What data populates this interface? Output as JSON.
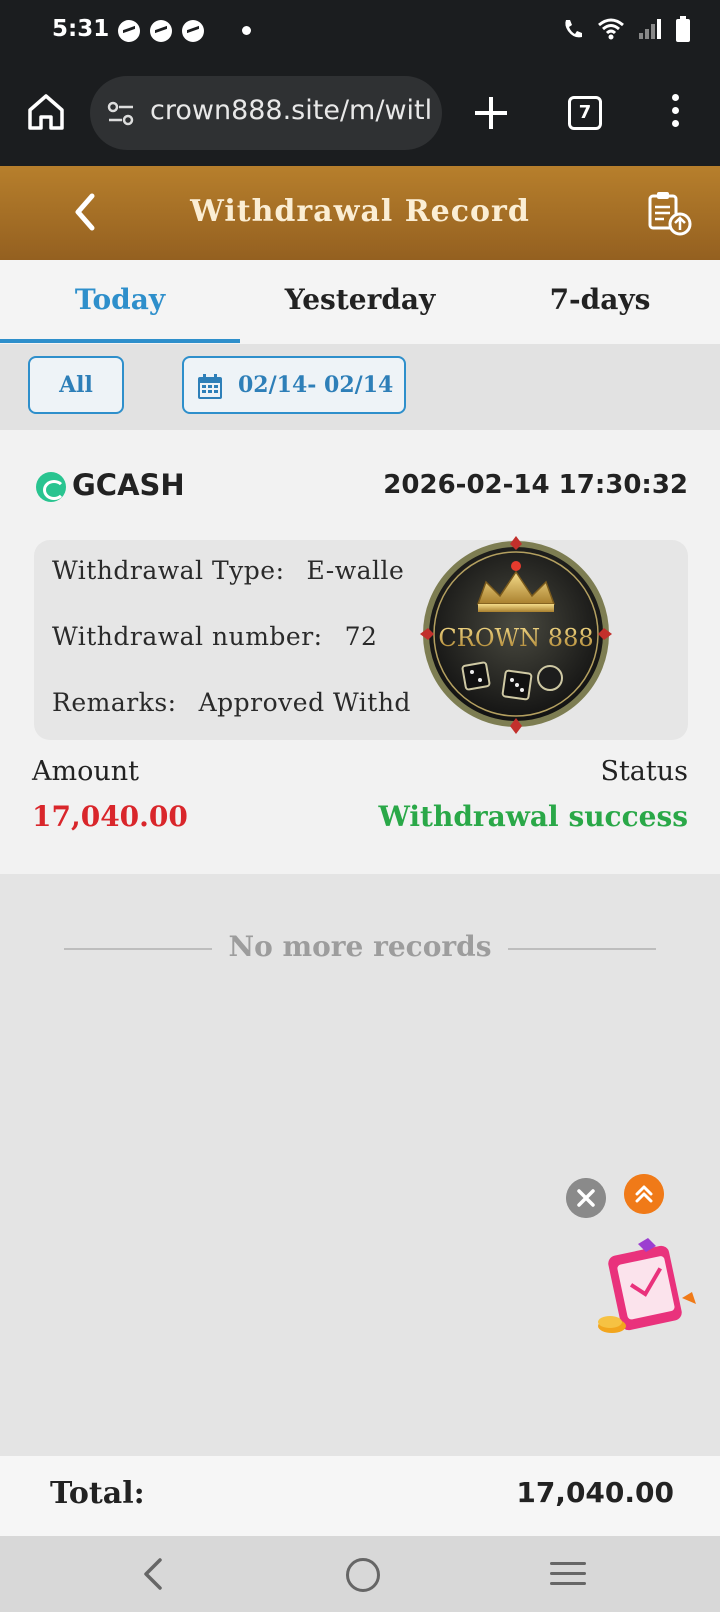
{
  "status_bar": {
    "time": "5:31",
    "notification_icons": [
      "messenger-icon",
      "messenger-icon",
      "messenger-icon"
    ],
    "system_icons": [
      "wifi-calling-icon",
      "wifi-icon",
      "signal-icon",
      "battery-icon"
    ]
  },
  "browser": {
    "url": "crown888.site/m/witl",
    "tab_count": "7"
  },
  "header": {
    "title": "Withdrawal Record"
  },
  "tabs": [
    {
      "label": "Today",
      "active": true
    },
    {
      "label": "Yesterday",
      "active": false
    },
    {
      "label": "7-days",
      "active": false
    }
  ],
  "filters": {
    "all_label": "All",
    "date_range": "02/14- 02/14"
  },
  "record": {
    "channel": "GCASH",
    "datetime": "2026-02-14 17:30:32",
    "type_label": "Withdrawal Type:",
    "type_value": "E-walle",
    "number_label": "Withdrawal number:",
    "number_value": "72",
    "remarks_label": "Remarks:",
    "remarks_value": "Approved Withd",
    "amount_label": "Amount",
    "amount_value": "17,040.00",
    "status_label": "Status",
    "status_value": "Withdrawal success"
  },
  "watermark": {
    "text": "CROWN 888"
  },
  "list_end_text": "No more records",
  "footer": {
    "total_label": "Total:",
    "total_value": "17,040.00"
  },
  "colors": {
    "header_gold": "#b77f2c",
    "accent_blue": "#2e8fcb",
    "amount_red": "#d9262b",
    "success_green": "#2aa848",
    "float_orange": "#f07a18"
  }
}
